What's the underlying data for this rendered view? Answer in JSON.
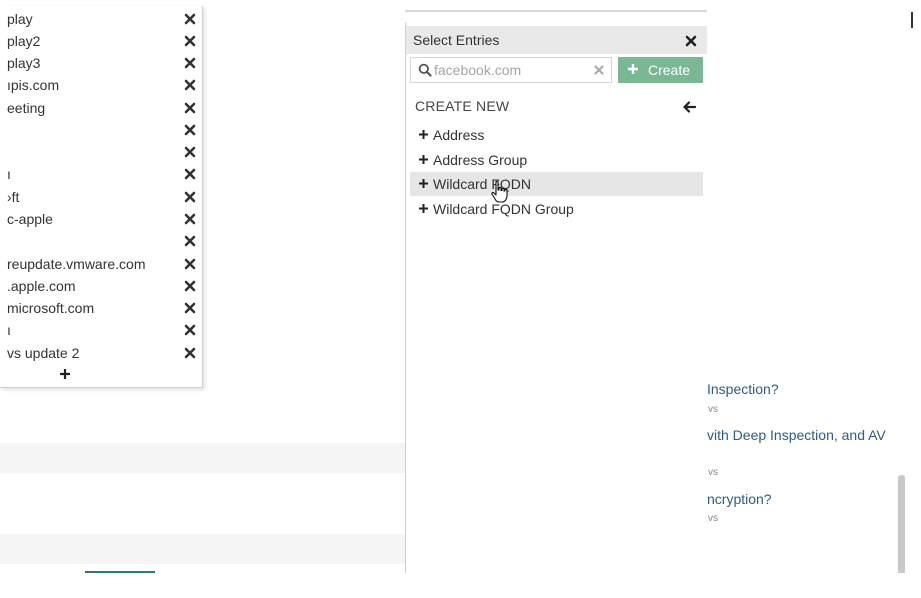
{
  "entries": [
    {
      "label": "play"
    },
    {
      "label": "play2"
    },
    {
      "label": "play3"
    },
    {
      "label": "ıpis.com"
    },
    {
      "label": "eeting"
    },
    {
      "label": ""
    },
    {
      "label": ""
    },
    {
      "label": "ı"
    },
    {
      "label": "›ft"
    },
    {
      "label": "c-apple"
    },
    {
      "label": ""
    },
    {
      "label": "reupdate.vmware.com"
    },
    {
      "label": ".apple.com"
    },
    {
      "label": "microsoft.com"
    },
    {
      "label": "ı"
    },
    {
      "label": "vs update 2"
    }
  ],
  "select_panel": {
    "title": "Select Entries",
    "search": {
      "value": "",
      "placeholder": "facebook.com"
    },
    "create_label": "Create",
    "section_title": "CREATE NEW",
    "options": [
      {
        "label": "Address"
      },
      {
        "label": "Address Group"
      },
      {
        "label": "Wildcard FQDN"
      },
      {
        "label": "Wildcard FQDN Group"
      }
    ]
  },
  "related": {
    "links": [
      {
        "text": "Inspection?",
        "meta": "vs"
      },
      {
        "text": "vith Deep Inspection, and AV",
        "meta": "vs"
      },
      {
        "text": "ncryption?",
        "meta": "vs"
      }
    ]
  },
  "colors": {
    "create_button": "#7ab893",
    "link": "#2d5b8a",
    "hover_row": "#e6e6e6",
    "header": "#e9e9e9"
  },
  "icons": {
    "remove": "close-icon",
    "add": "plus-icon",
    "search": "search-icon",
    "back": "arrow-left-icon",
    "cursor": "hand-cursor-icon"
  }
}
